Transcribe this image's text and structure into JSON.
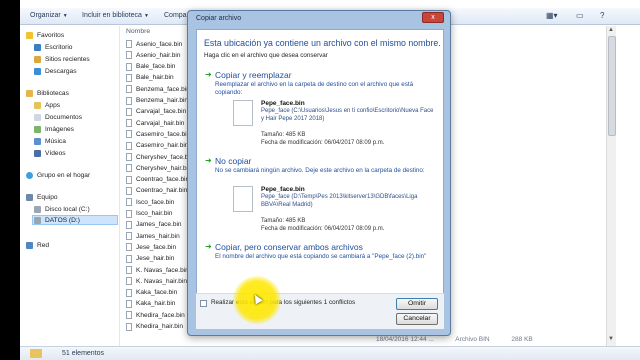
{
  "toolbar": {
    "organize": "Organizar",
    "include": "Incluir en biblioteca",
    "share": "Compa"
  },
  "nav": {
    "favorites": "Favoritos",
    "desktop": "Escritorio",
    "recent": "Sitios recientes",
    "downloads": "Descargas",
    "libraries": "Bibliotecas",
    "apps": "Apps",
    "documents": "Documentos",
    "images": "Imágenes",
    "music": "Música",
    "videos": "Vídeos",
    "homegroup": "Grupo en el hogar",
    "computer": "Equipo",
    "drive_c": "Disco local (C:)",
    "drive_d": "DATOS (D:)",
    "network": "Red"
  },
  "filelist": {
    "header": "Nombre",
    "files": [
      "Asenio_face.bin",
      "Asenio_hair.bin",
      "Bale_face.bin",
      "Bale_hair.bin",
      "Benzema_face.bin",
      "Benzema_hair.bin",
      "Carvajal_face.bin",
      "Carvajal_hair.bin",
      "Casemiro_face.bin",
      "Casemiro_hair.bin",
      "Cheryshev_face.bin",
      "Cheryshev_hair.bin",
      "Coentrao_face.bin",
      "Coentrao_hair.bin",
      "Isco_face.bin",
      "Isco_hair.bin",
      "James_face.bin",
      "James_hair.bin",
      "Jese_face.bin",
      "Jese_hair.bin",
      "K. Navas_face.bin",
      "K. Navas_hair.bin",
      "Kaka_face.bin",
      "Kaka_hair.bin",
      "Khedira_face.bin",
      "Khedira_hair.bin"
    ],
    "last_row": {
      "date": "18/04/2016 12:44 ...",
      "type": "Archivo BIN",
      "size": "288 KB"
    }
  },
  "status": {
    "count": "51 elementos"
  },
  "dialog": {
    "title": "Copiar archivo",
    "close": "x",
    "heading": "Esta ubicación ya contiene un archivo con el mismo nombre.",
    "sub": "Haga clic en el archivo que desea conservar",
    "replace": {
      "title": "Copiar y reemplazar",
      "desc": "Reemplazar el archivo en la carpeta de destino con el archivo que está copiando:",
      "name": "Pepe_face.bin",
      "path": "Pepe_face (C:\\Usuarios\\Jesus en ti confio\\Escritorio\\Nueva Face y Hair Pepe 2017 2018)",
      "size": "Tamaño: 485 KB",
      "date": "Fecha de modificación: 06/04/2017 08:09 p.m."
    },
    "keep": {
      "title": "No copiar",
      "desc": "No se cambiará ningún archivo. Deje este archivo en la carpeta de destino:",
      "name": "Pepe_face.bin",
      "path": "Pepe_face (D:\\Temp\\Pes 2013\\kitserver13\\GDB\\faces\\Liga BBVA\\Real Madrid)",
      "size": "Tamaño: 485 KB",
      "date": "Fecha de modificación: 06/04/2017 08:09 p.m."
    },
    "both": {
      "title": "Copiar, pero conservar ambos archivos",
      "desc": "El nombre del archivo que está copiando se cambiará a \"Pepe_face (2).bin\""
    },
    "checkbox": "Realizar esta acción para los siguientes 1 conflictos",
    "skip": "Omitir",
    "cancel": "Cancelar"
  }
}
